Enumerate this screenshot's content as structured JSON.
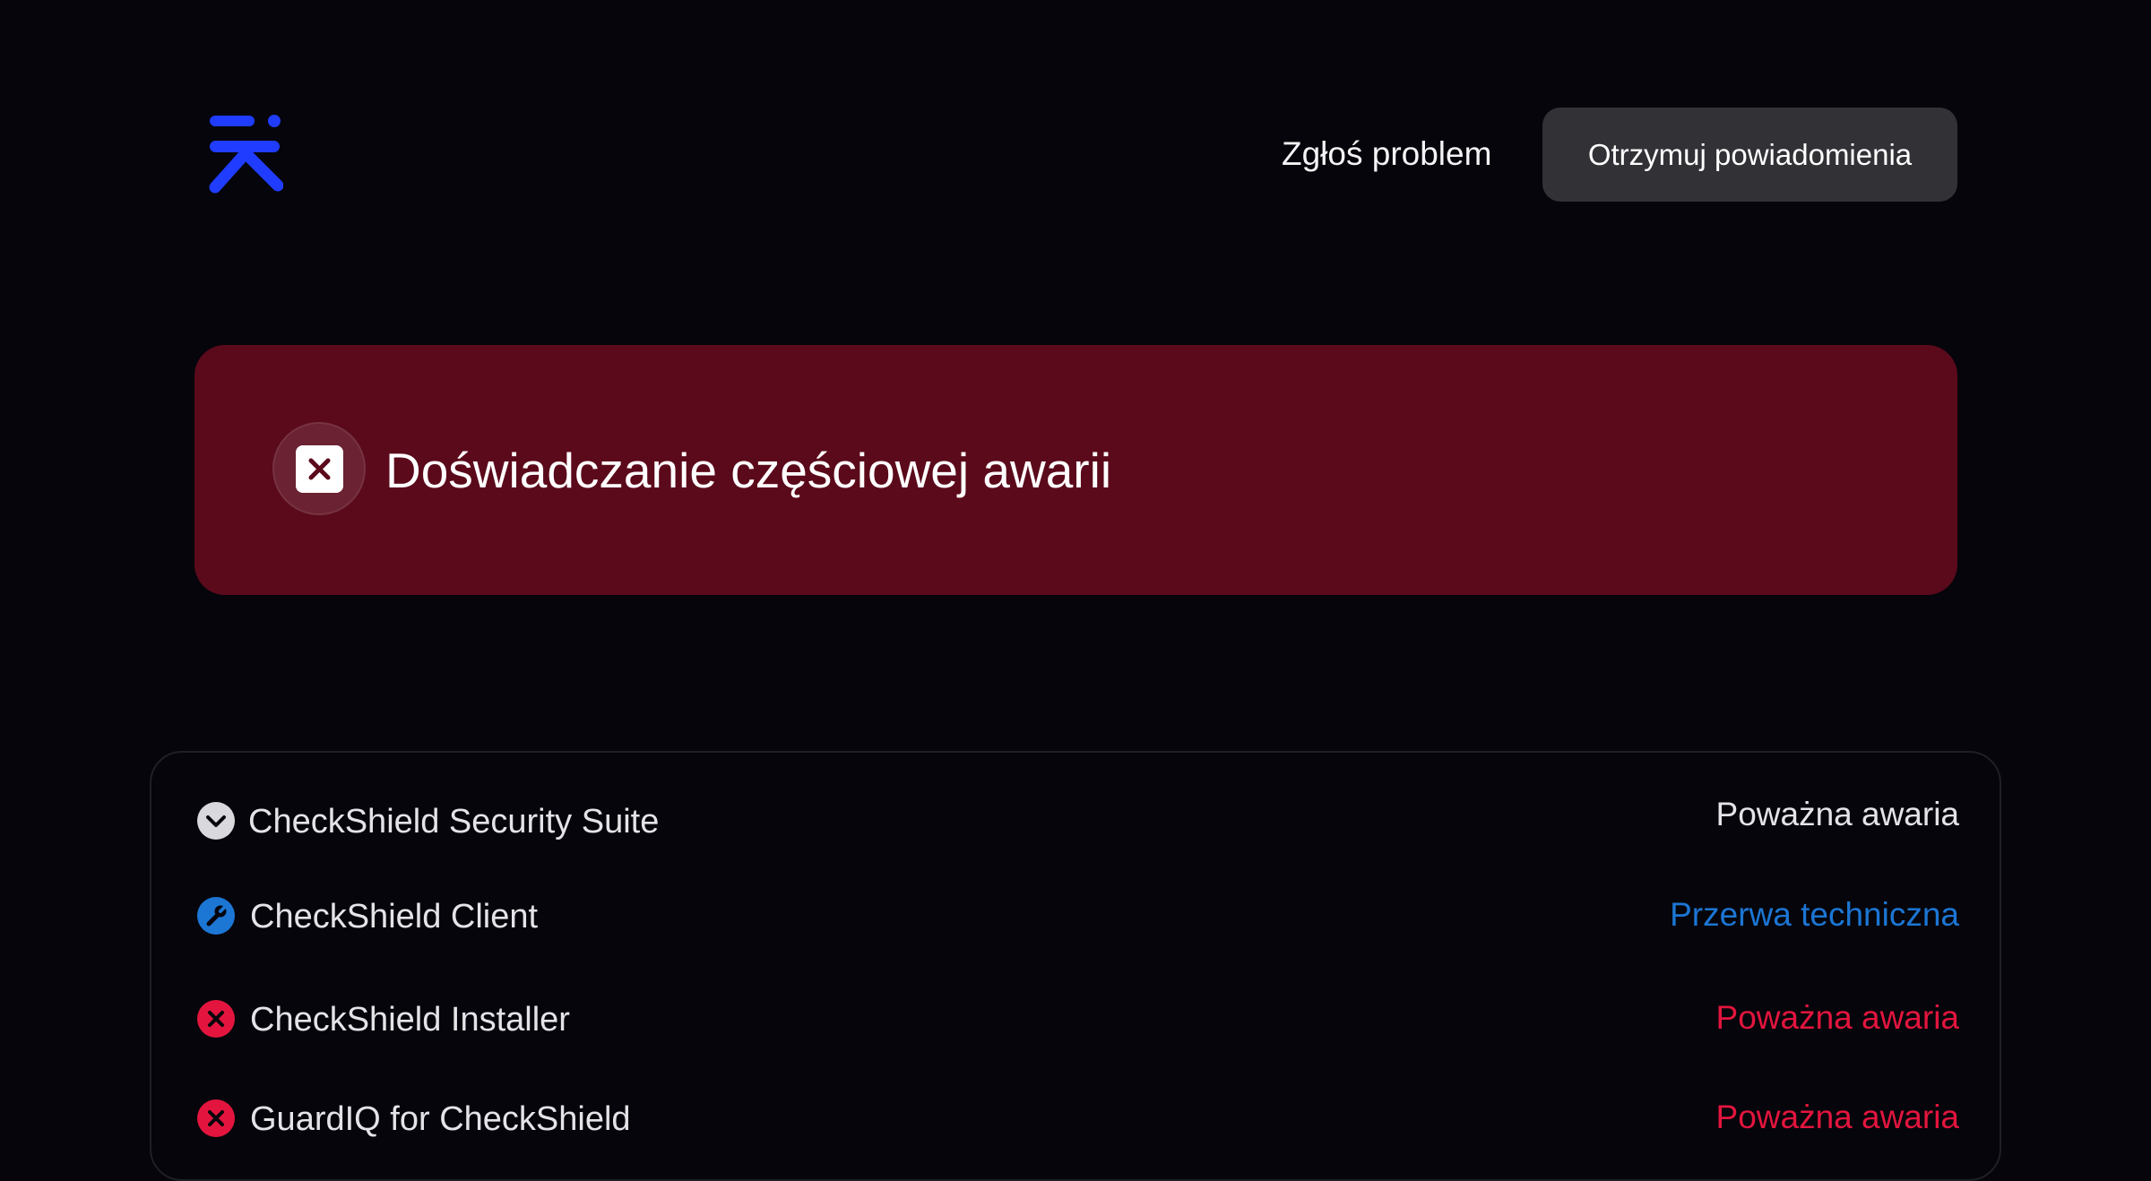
{
  "header": {
    "logo_icon": "brand-logo-icon",
    "report_link_label": "Zgłoś problem",
    "subscribe_button_label": "Otrzymuj powiadomienia"
  },
  "banner": {
    "icon": "x-square-icon",
    "title": "Doświadczanie częściowej awarii",
    "color": "#5b0a1b"
  },
  "components": [
    {
      "name": "CheckShield Security Suite",
      "status": "Poważna awaria",
      "icon": "chevron-down-icon",
      "expandable": true
    },
    {
      "name": "CheckShield Client",
      "status": "Przerwa techniczna",
      "icon": "wrench-icon"
    },
    {
      "name": "CheckShield Installer",
      "status": "Poważna awaria",
      "icon": "x-circle-icon"
    },
    {
      "name": "GuardIQ for CheckShield",
      "status": "Poważna awaria",
      "icon": "x-circle-icon"
    }
  ],
  "colors": {
    "background": "#05050b",
    "brand": "#1f3cff",
    "maintenance": "#1c76d4",
    "major_outage": "#e3153e",
    "button_bg": "#313136"
  }
}
